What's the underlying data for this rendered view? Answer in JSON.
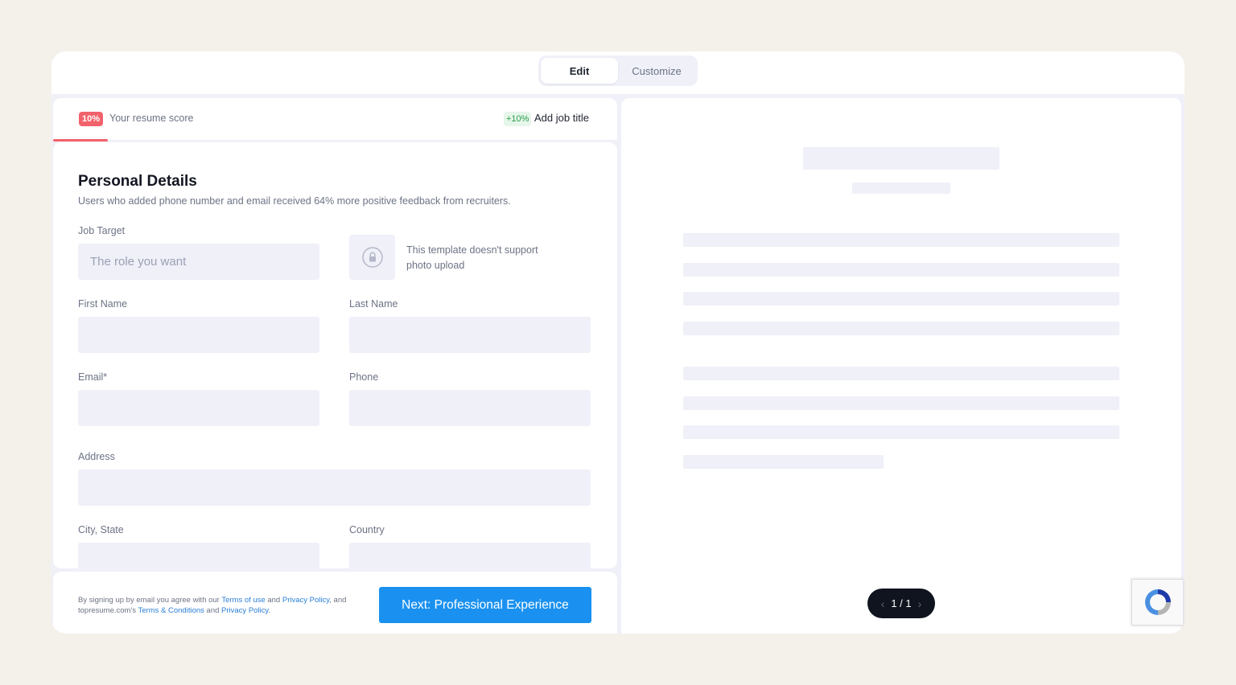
{
  "tabs": [
    {
      "label": "Edit",
      "active": true
    },
    {
      "label": "Customize",
      "active": false
    }
  ],
  "score": {
    "badge": "10%",
    "label": "Your resume score",
    "boost_badge": "+10%",
    "boost_label": "Add job title",
    "progress_percent": 10
  },
  "section": {
    "title": "Personal Details",
    "subtitle": "Users who added phone number and email received 64% more positive feedback from recruiters."
  },
  "fields": {
    "job_target": {
      "label": "Job Target",
      "placeholder": "The role you want",
      "value": ""
    },
    "first_name": {
      "label": "First Name",
      "value": ""
    },
    "last_name": {
      "label": "Last Name",
      "value": ""
    },
    "email": {
      "label": "Email*",
      "value": ""
    },
    "phone": {
      "label": "Phone",
      "value": ""
    },
    "address": {
      "label": "Address",
      "value": ""
    },
    "city_state": {
      "label": "City, State",
      "value": ""
    },
    "country": {
      "label": "Country",
      "value": ""
    }
  },
  "photo": {
    "text": "This template doesn't support photo upload",
    "icon": "lock-icon"
  },
  "footer": {
    "legal_1": "By signing up by email you agree with our",
    "terms_link": "Terms of use",
    "and_1": "and",
    "privacy_link_1": "Privacy Policy",
    "legal_2": ", and topresume.com's",
    "conditions_link": "Terms & Conditions",
    "and_2": "and",
    "privacy_link_2": "Privacy Policy",
    "period": ".",
    "next_button": "Next: Professional Experience"
  },
  "preview": {
    "pager": "1 / 1"
  },
  "colors": {
    "accent": "#1a91f0",
    "score_red": "#f2626b",
    "boost_green": "#2a9d4a",
    "background": "#f4f1eb"
  }
}
